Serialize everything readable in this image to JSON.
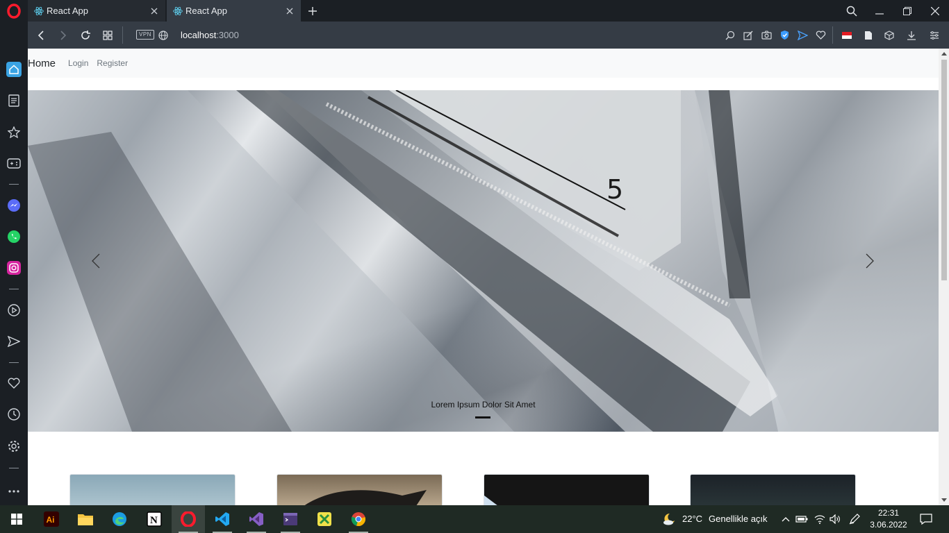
{
  "browser": {
    "name": "Opera",
    "tabs": [
      {
        "title": "React App",
        "favicon": "react-icon",
        "active": false
      },
      {
        "title": "React App",
        "favicon": "react-icon",
        "active": true
      }
    ],
    "new_tab_icon": "plus-icon",
    "window_controls": [
      "search-icon",
      "minimize-icon",
      "restore-icon",
      "close-icon"
    ],
    "address_bar": {
      "vpn_label": "VPN",
      "url_host": "localhost",
      "url_port": ":3000",
      "left_icons": [
        "back-icon",
        "forward-icon",
        "reload-icon",
        "tabs-grid-icon",
        "globe-icon"
      ],
      "right_icons": [
        "search-zoom-icon",
        "edit-icon",
        "camera-icon",
        "shield-icon",
        "send-icon",
        "heart-icon",
        "flag-icon",
        "page-icon",
        "cube-icon",
        "download-icon",
        "menu-icon"
      ]
    },
    "sidebar_icons": [
      "home-icon",
      "notes-icon",
      "bookmarks-icon",
      "gamepad-icon",
      "messenger-icon",
      "whatsapp-icon",
      "instagram-icon",
      "player-icon",
      "send-icon",
      "heart-icon",
      "history-icon",
      "settings-icon",
      "more-icon"
    ]
  },
  "page": {
    "navbar": {
      "brand": "Home",
      "links": [
        "Login",
        "Register"
      ]
    },
    "carousel": {
      "caption": "Lorem Ipsum Dolor Sit Amet",
      "prev_icon": "chevron-left-icon",
      "next_icon": "chevron-right-icon",
      "image_text": "5"
    }
  },
  "taskbar": {
    "start_icon": "windows-start-icon",
    "apps": [
      "illustrator-icon",
      "file-explorer-icon",
      "edge-icon",
      "notion-icon",
      "opera-icon",
      "vscode-icon",
      "visual-studio-icon",
      "terminal-icon",
      "xampp-icon",
      "chrome-icon"
    ],
    "weather": {
      "temp": "22°C",
      "description": "Genellikle açık",
      "icon": "moon-cloud-icon"
    },
    "tray_icons": [
      "chevron-up-icon",
      "battery-icon",
      "wifi-icon",
      "volume-icon",
      "pen-icon"
    ],
    "clock": {
      "time": "22:31",
      "date": "3.06.2022"
    },
    "notification_icon": "notification-icon"
  }
}
